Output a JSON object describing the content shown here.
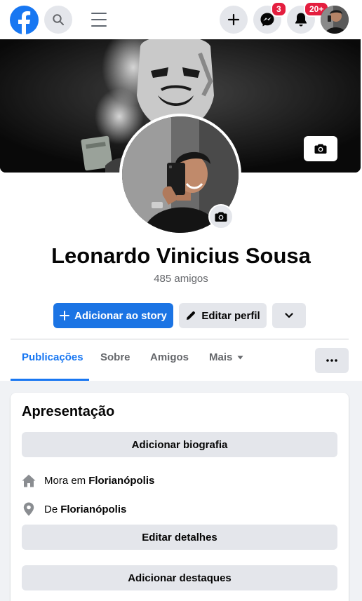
{
  "topbar": {
    "logo_icon": "facebook-logo-icon",
    "search_icon": "search-icon",
    "menu_icon": "hamburger-menu-icon",
    "create_icon": "plus-icon",
    "messenger_icon": "messenger-icon",
    "messenger_badge": "3",
    "notifications_icon": "bell-icon",
    "notifications_badge": "20+",
    "brand_color": "#1877f2",
    "badge_color": "#e41e3f"
  },
  "profile": {
    "name": "Leonardo Vinicius Sousa",
    "friends_count": "485 amigos",
    "cover_camera_icon": "camera-icon",
    "picture_camera_icon": "camera-icon"
  },
  "actions": {
    "add_story_label": "Adicionar ao story",
    "edit_profile_label": "Editar perfil",
    "dropdown_icon": "chevron-down-icon"
  },
  "tabs": [
    {
      "label": "Publicações",
      "active": true
    },
    {
      "label": "Sobre",
      "active": false
    },
    {
      "label": "Amigos",
      "active": false
    },
    {
      "label": "Mais",
      "active": false
    }
  ],
  "intro": {
    "title": "Apresentação",
    "add_bio_label": "Adicionar biografia",
    "lives_in_prefix": "Mora em",
    "lives_in_city": "Florianópolis",
    "from_prefix": "De",
    "from_city": "Florianópolis",
    "edit_details_label": "Editar detalhes",
    "add_highlights_label": "Adicionar destaques"
  }
}
